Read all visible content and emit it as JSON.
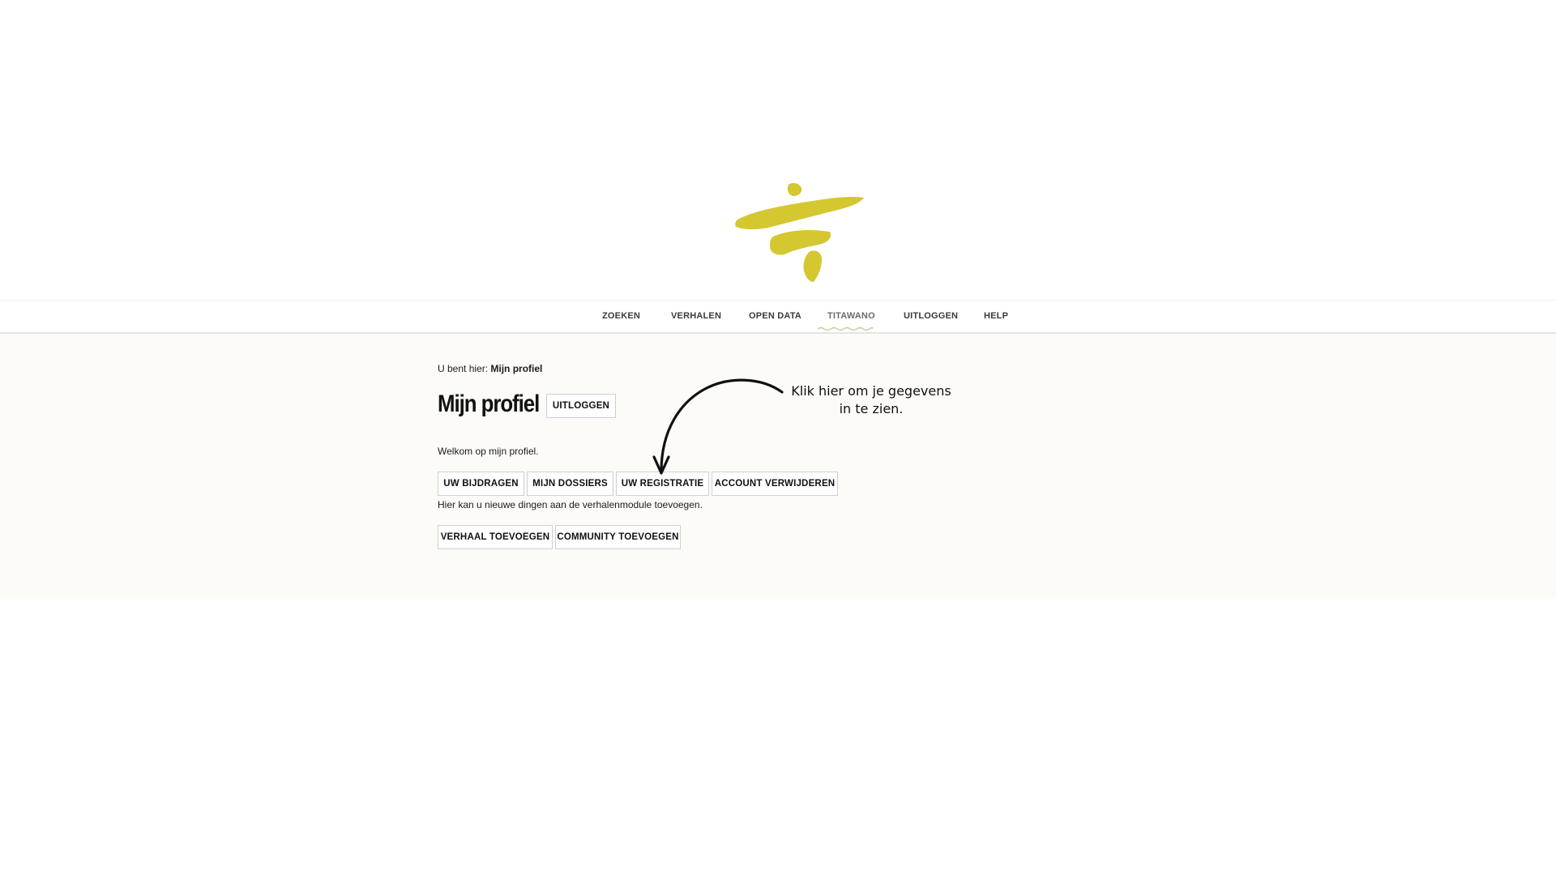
{
  "colors": {
    "brand": "#d4c730",
    "background": "#fcfbf7",
    "nav_underline": "#cfc59a"
  },
  "logo": {
    "icon": "yellow-brush-logo-icon"
  },
  "nav": {
    "items": [
      {
        "label": "ZOEKEN"
      },
      {
        "label": "VERHALEN"
      },
      {
        "label": "OPEN DATA"
      },
      {
        "label": "TITAWANO",
        "active": true
      },
      {
        "label": "UITLOGGEN"
      },
      {
        "label": "HELP"
      }
    ]
  },
  "breadcrumb": {
    "prefix": "U bent hier:",
    "current": "Mijn profiel"
  },
  "page": {
    "title": "Mijn profiel",
    "logout_button": "UITLOGGEN",
    "welcome_text": "Welkom op mijn profiel.",
    "hint_text": "Hier kan u nieuwe dingen aan de verhalenmodule toevoegen."
  },
  "profile_buttons": [
    {
      "label": "UW BIJDRAGEN"
    },
    {
      "label": "MIJN DOSSIERS"
    },
    {
      "label": "UW REGISTRATIE"
    },
    {
      "label": "ACCOUNT VERWIJDEREN"
    }
  ],
  "add_buttons": [
    {
      "label": "VERHAAL TOEVOEGEN"
    },
    {
      "label": "COMMUNITY TOEVOEGEN"
    }
  ],
  "annotation": {
    "line1": "Klik hier om je gegevens",
    "line2": "in te zien.",
    "icon": "curved-arrow-icon"
  }
}
